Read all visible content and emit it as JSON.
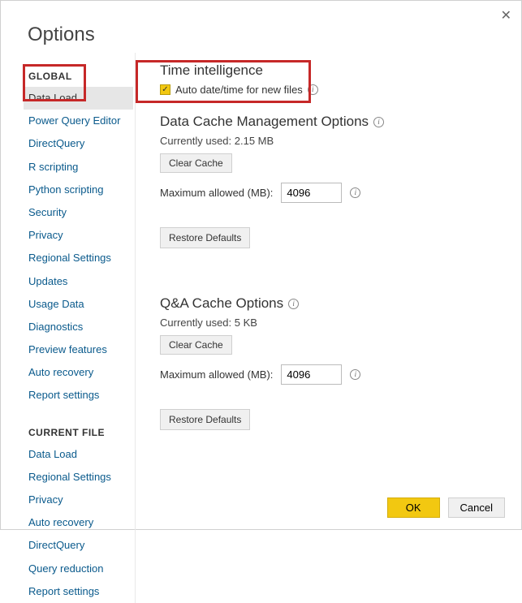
{
  "title": "Options",
  "sidebar": {
    "global_header": "GLOBAL",
    "global_items": [
      "Data Load",
      "Power Query Editor",
      "DirectQuery",
      "R scripting",
      "Python scripting",
      "Security",
      "Privacy",
      "Regional Settings",
      "Updates",
      "Usage Data",
      "Diagnostics",
      "Preview features",
      "Auto recovery",
      "Report settings"
    ],
    "current_file_header": "CURRENT FILE",
    "current_file_items": [
      "Data Load",
      "Regional Settings",
      "Privacy",
      "Auto recovery",
      "DirectQuery",
      "Query reduction",
      "Report settings"
    ]
  },
  "main": {
    "time_intelligence": {
      "title": "Time intelligence",
      "checkbox_label": "Auto date/time for new files"
    },
    "data_cache": {
      "title": "Data Cache Management Options",
      "used_label": "Currently used: 2.15 MB",
      "clear_label": "Clear Cache",
      "max_label": "Maximum allowed (MB):",
      "max_value": "4096",
      "restore_label": "Restore Defaults"
    },
    "qa_cache": {
      "title": "Q&A Cache Options",
      "used_label": "Currently used: 5 KB",
      "clear_label": "Clear Cache",
      "max_label": "Maximum allowed (MB):",
      "max_value": "4096",
      "restore_label": "Restore Defaults"
    }
  },
  "footer": {
    "ok": "OK",
    "cancel": "Cancel"
  }
}
